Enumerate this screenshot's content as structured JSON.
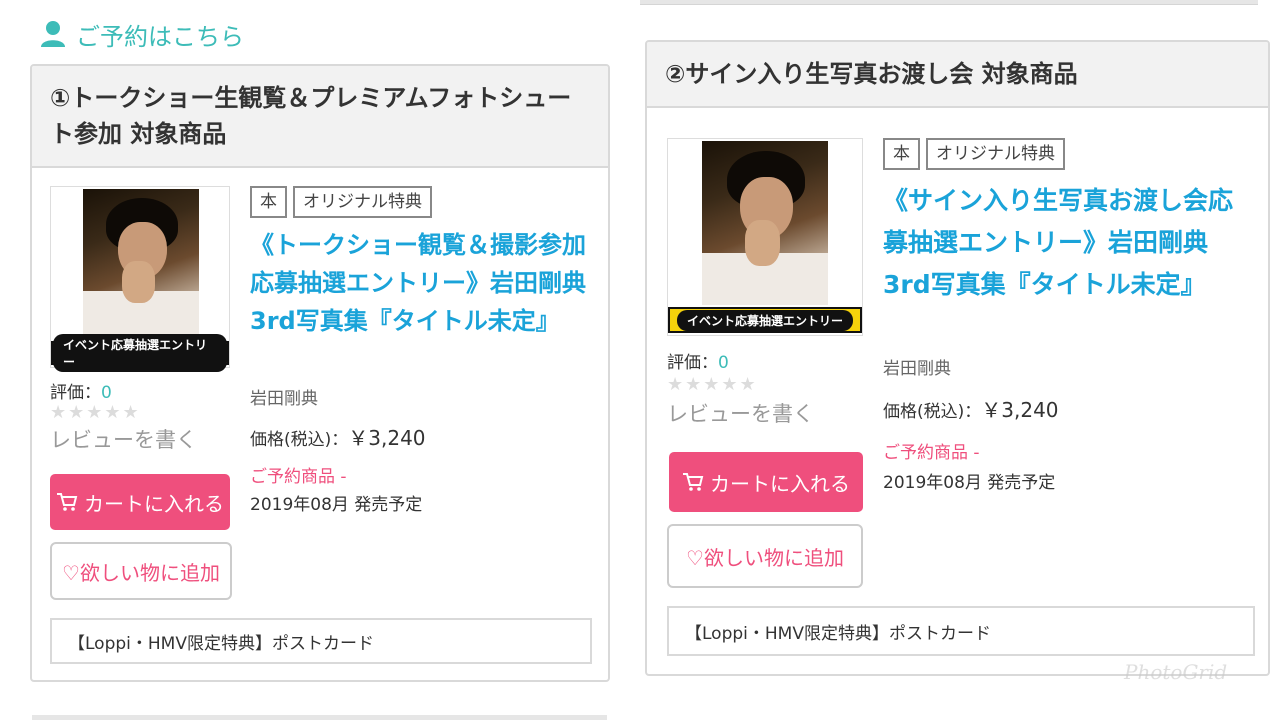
{
  "header": {
    "reserve_label": "ご予約はこちら"
  },
  "left": {
    "section_title": "①トークショー生観覧＆プレミアムフォトシュート参加 対象商品",
    "banner_text": "イベント応募抽選エントリー",
    "rating_label": "評価：",
    "rating_value": "0",
    "stars": "★★★★★",
    "review_label": "レビューを書く",
    "cart_label": "カートに入れる",
    "wish_label": "♡欲しい物に追加",
    "tags": [
      "本",
      "オリジナル特典"
    ],
    "title": "《トークショー観覧＆撮影参加 応募抽選エントリー》岩田剛典3rd写真集『タイトル未定』",
    "author": "岩田剛典",
    "price_label": "価格(税込)：",
    "price": "￥3,240",
    "preorder": "ご予約商品 -",
    "release": "2019年08月 発売予定",
    "bonus": "【Loppi・HMV限定特典】ポストカード"
  },
  "right": {
    "section_title": "②サイン入り生写真お渡し会 対象商品",
    "banner_text": "イベント応募抽選エントリー",
    "rating_label": "評価：",
    "rating_value": "0",
    "stars": "★★★★★",
    "review_label": "レビューを書く",
    "cart_label": "カートに入れる",
    "wish_label": "♡欲しい物に追加",
    "tags": [
      "本",
      "オリジナル特典"
    ],
    "title": "《サイン入り生写真お渡し会応募抽選エントリー》岩田剛典3rd写真集『タイトル未定』",
    "author": "岩田剛典",
    "price_label": "価格(税込)：",
    "price": "￥3,240",
    "preorder": "ご予約商品 -",
    "release": "2019年08月 発売予定",
    "bonus": "【Loppi・HMV限定特典】ポストカード"
  },
  "watermark": "PhotoGrid",
  "colors": {
    "accent_teal": "#3dbcb8",
    "link_blue": "#1aa3d9",
    "pink": "#ef4f7d"
  }
}
